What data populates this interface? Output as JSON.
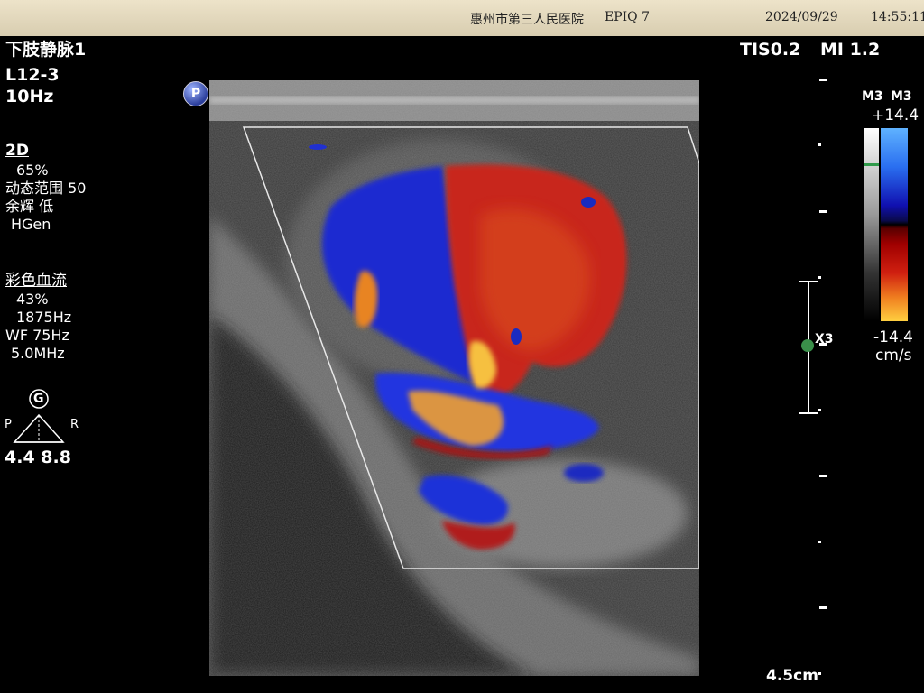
{
  "header": {
    "hospital": "惠州市第三人民医院",
    "system": "EPIQ 7",
    "date": "2024/09/29",
    "time": "14:55:11"
  },
  "exam": {
    "preset": "下肢静脉1",
    "probe": "L12-3",
    "frame_rate": "10Hz"
  },
  "indices": {
    "tis": "TIS0.2",
    "mi": "MI 1.2"
  },
  "mode_2d": {
    "title": "2D",
    "gain": "65%",
    "dynamic_range": "动态范围 50",
    "persistence": "余辉 低",
    "frequency_mode": "HGen"
  },
  "color_flow": {
    "title": "彩色血流",
    "gain": "43%",
    "prf": "1875Hz",
    "wall_filter": "WF  75Hz",
    "frequency": "5.0MHz"
  },
  "biopsy_guide": {
    "g_label": "G",
    "p_label": "P",
    "r_label": "R",
    "values": "4.4  8.8"
  },
  "colorbar": {
    "map_label_gray": "M3",
    "map_label_color": "M3",
    "top_velocity": "+14.4",
    "bottom_velocity": "-14.4",
    "unit": "cm/s",
    "colors": [
      "#5fb2ff",
      "#1010b0",
      "#000000",
      "#a00000",
      "#ffd040"
    ]
  },
  "zoom": {
    "label": "X3"
  },
  "depth": {
    "value": "4.5cm"
  },
  "badge": {
    "label": "P"
  }
}
